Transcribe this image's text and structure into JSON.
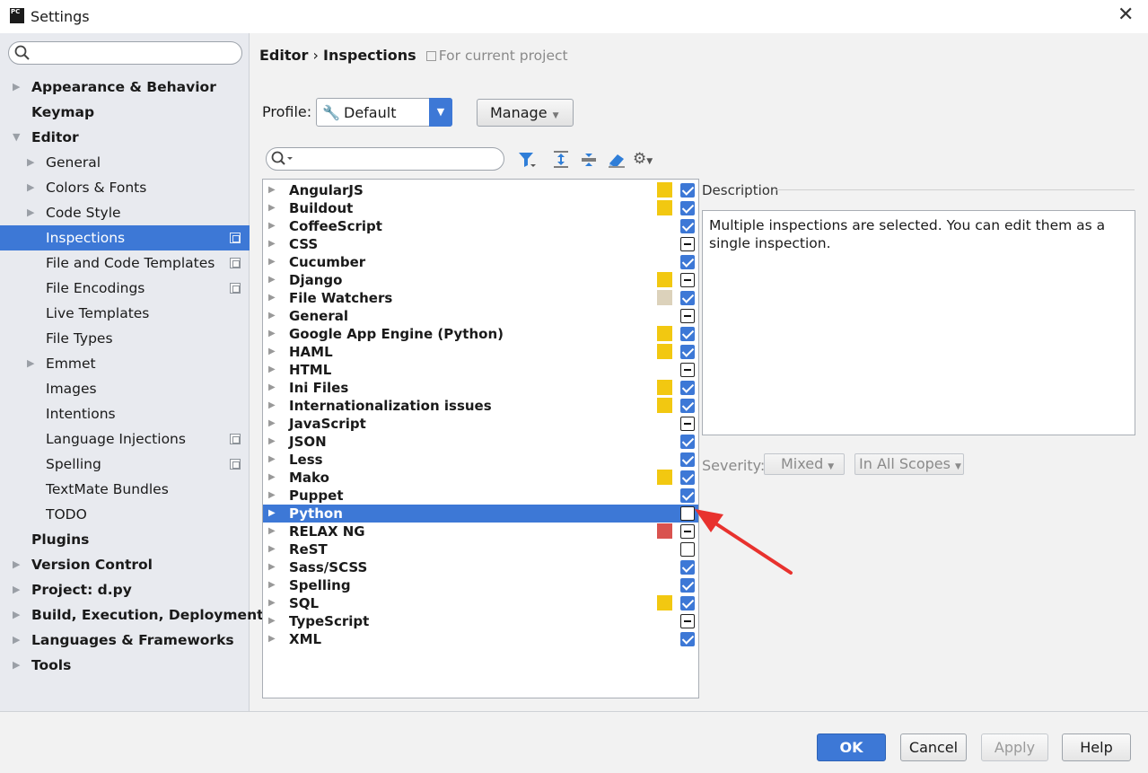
{
  "window": {
    "title": "Settings",
    "app_icon": "PC",
    "close_glyph": "✕"
  },
  "sidebar": {
    "search_placeholder": "",
    "items": [
      {
        "label": "Appearance & Behavior",
        "level": 0,
        "expandable": true,
        "expanded": false
      },
      {
        "label": "Keymap",
        "level": 0,
        "expandable": false
      },
      {
        "label": "Editor",
        "level": 0,
        "expandable": true,
        "expanded": true
      },
      {
        "label": "General",
        "level": 1,
        "expandable": true,
        "expanded": false
      },
      {
        "label": "Colors & Fonts",
        "level": 1,
        "expandable": true,
        "expanded": false
      },
      {
        "label": "Code Style",
        "level": 1,
        "expandable": true,
        "expanded": false
      },
      {
        "label": "Inspections",
        "level": 1,
        "expandable": false,
        "selected": true,
        "copy_icon": true
      },
      {
        "label": "File and Code Templates",
        "level": 1,
        "expandable": false,
        "copy_icon": true
      },
      {
        "label": "File Encodings",
        "level": 1,
        "expandable": false,
        "copy_icon": true
      },
      {
        "label": "Live Templates",
        "level": 1,
        "expandable": false
      },
      {
        "label": "File Types",
        "level": 1,
        "expandable": false
      },
      {
        "label": "Emmet",
        "level": 1,
        "expandable": true,
        "expanded": false
      },
      {
        "label": "Images",
        "level": 1,
        "expandable": false
      },
      {
        "label": "Intentions",
        "level": 1,
        "expandable": false
      },
      {
        "label": "Language Injections",
        "level": 1,
        "expandable": false,
        "copy_icon": true
      },
      {
        "label": "Spelling",
        "level": 1,
        "expandable": false,
        "copy_icon": true
      },
      {
        "label": "TextMate Bundles",
        "level": 1,
        "expandable": false
      },
      {
        "label": "TODO",
        "level": 1,
        "expandable": false
      },
      {
        "label": "Plugins",
        "level": 0,
        "expandable": false
      },
      {
        "label": "Version Control",
        "level": 0,
        "expandable": true,
        "expanded": false
      },
      {
        "label": "Project: d.py",
        "level": 0,
        "expandable": true,
        "expanded": false
      },
      {
        "label": "Build, Execution, Deployment",
        "level": 0,
        "expandable": true,
        "expanded": false
      },
      {
        "label": "Languages & Frameworks",
        "level": 0,
        "expandable": true,
        "expanded": false
      },
      {
        "label": "Tools",
        "level": 0,
        "expandable": true,
        "expanded": false
      }
    ]
  },
  "breadcrumb": {
    "parent": "Editor",
    "separator": "›",
    "current": "Inspections",
    "scope": "For current project"
  },
  "profile": {
    "label": "Profile:",
    "value": "Default",
    "manage_label": "Manage"
  },
  "inspections": [
    {
      "name": "AngularJS",
      "swatch": "#f2c811",
      "state": "checked"
    },
    {
      "name": "Buildout",
      "swatch": "#f2c811",
      "state": "checked"
    },
    {
      "name": "CoffeeScript",
      "swatch": null,
      "state": "checked"
    },
    {
      "name": "CSS",
      "swatch": null,
      "state": "mixed"
    },
    {
      "name": "Cucumber",
      "swatch": null,
      "state": "checked"
    },
    {
      "name": "Django",
      "swatch": "#f2c811",
      "state": "mixed"
    },
    {
      "name": "File Watchers",
      "swatch": "#dcd2bb",
      "state": "checked"
    },
    {
      "name": "General",
      "swatch": null,
      "state": "mixed"
    },
    {
      "name": "Google App Engine (Python)",
      "swatch": "#f2c811",
      "state": "checked"
    },
    {
      "name": "HAML",
      "swatch": "#f2c811",
      "state": "checked"
    },
    {
      "name": "HTML",
      "swatch": null,
      "state": "mixed"
    },
    {
      "name": "Ini Files",
      "swatch": "#f2c811",
      "state": "checked"
    },
    {
      "name": "Internationalization issues",
      "swatch": "#f2c811",
      "state": "checked"
    },
    {
      "name": "JavaScript",
      "swatch": null,
      "state": "mixed"
    },
    {
      "name": "JSON",
      "swatch": null,
      "state": "checked"
    },
    {
      "name": "Less",
      "swatch": null,
      "state": "checked"
    },
    {
      "name": "Mako",
      "swatch": "#f2c811",
      "state": "checked"
    },
    {
      "name": "Puppet",
      "swatch": null,
      "state": "checked"
    },
    {
      "name": "Python",
      "swatch": null,
      "state": "unchecked",
      "selected": true
    },
    {
      "name": "RELAX NG",
      "swatch": "#d9534f",
      "state": "mixed"
    },
    {
      "name": "ReST",
      "swatch": null,
      "state": "unchecked"
    },
    {
      "name": "Sass/SCSS",
      "swatch": null,
      "state": "checked"
    },
    {
      "name": "Spelling",
      "swatch": null,
      "state": "checked"
    },
    {
      "name": "SQL",
      "swatch": "#f2c811",
      "state": "checked"
    },
    {
      "name": "TypeScript",
      "swatch": null,
      "state": "mixed"
    },
    {
      "name": "XML",
      "swatch": null,
      "state": "checked"
    }
  ],
  "description": {
    "label": "Description",
    "text": "Multiple inspections are selected. You can edit them as a single inspection."
  },
  "severity": {
    "label": "Severity:",
    "value": "Mixed",
    "scope_value": "In All Scopes"
  },
  "buttons": {
    "ok": "OK",
    "cancel": "Cancel",
    "apply": "Apply",
    "help": "Help"
  },
  "colors": {
    "accent": "#3d78d6",
    "annotation_arrow": "#e8322e"
  }
}
